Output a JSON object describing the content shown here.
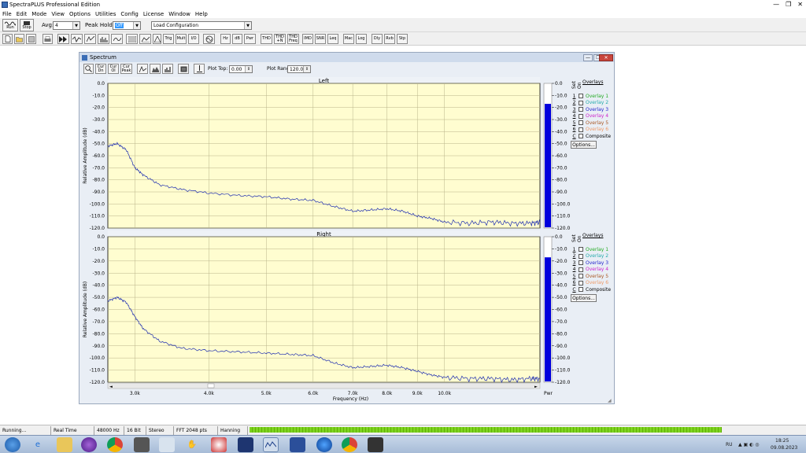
{
  "app": {
    "title": "SpectraPLUS Professional Edition"
  },
  "window_controls": {
    "minimize": "—",
    "restore": "❐",
    "close": "✕"
  },
  "menu": [
    "File",
    "Edit",
    "Mode",
    "View",
    "Options",
    "Utilities",
    "Config",
    "License",
    "Window",
    "Help"
  ],
  "toolbar": {
    "run_label": "Run",
    "stop_label": "Stop",
    "avg_label": "Avg:",
    "avg_value": "4",
    "peak_hold_label": "Peak Hold:",
    "peak_hold_value": "Off",
    "config_value": "Load Configuration",
    "text_buttons": [
      "Hz",
      "dB",
      "Pwr",
      "THD",
      "THD +N",
      "THD Freq",
      "IMD",
      "SNR",
      "Leq",
      "Mac",
      "Log",
      "Dly",
      "Rvb",
      "Stp"
    ],
    "icon_buttons": [
      "new-file-icon",
      "open-folder-icon",
      "save-icon",
      "print-icon",
      "play-icon",
      "record-icon",
      "waveform-icon",
      "spectrum-icon",
      "settings-icon",
      "calibration-icon",
      "trigger-icon"
    ],
    "trig_label": "Trig",
    "mult_label": "Mult",
    "io_label": "I/O"
  },
  "spectrum_window": {
    "title": "Spectrum",
    "small_buttons": [
      "Cur Dn",
      "Cur Ol",
      "Cur Peak"
    ],
    "plot_top_label": "Plot Top:",
    "plot_top_value": "0.00",
    "plot_range_label": "Plot Range:",
    "plot_range_value": "120.0"
  },
  "chart_data": [
    {
      "type": "line",
      "title": "Left",
      "ylabel": "Relative Amplitude (dB)",
      "xlabel": "",
      "x_scale": "log",
      "y_ticks": [
        "0.0",
        "-10.0",
        "-20.0",
        "-30.0",
        "-40.0",
        "-50.0",
        "-60.0",
        "-70.0",
        "-80.0",
        "-90.0",
        "-100.0",
        "-110.0",
        "-120.0"
      ],
      "ylim": [
        -120,
        0
      ],
      "xlim": [
        2700,
        14500
      ],
      "series": [
        {
          "x": [
            2700,
            2800,
            2900,
            3000,
            3100,
            3300,
            3600,
            4000,
            4500,
            5000,
            5500,
            6000,
            6500,
            7000,
            7500,
            8000,
            8500,
            9000,
            9500,
            10000,
            11000,
            12000,
            13000,
            14000,
            14500
          ],
          "values": [
            -52,
            -50,
            -55,
            -70,
            -76,
            -84,
            -88,
            -91,
            -93,
            -94,
            -96,
            -97,
            -102,
            -106,
            -105,
            -104,
            -106,
            -110,
            -112,
            -115,
            -116,
            -115,
            -116,
            -116,
            -115
          ]
        }
      ],
      "meter": {
        "value": -17,
        "ticks": [
          "0.0",
          "-10.0",
          "-20.0",
          "-30.0",
          "-40.0",
          "-50.0",
          "-60.0",
          "-70.0",
          "-80.0",
          "-90.0",
          "-100.0",
          "-110.0",
          "-120.0"
        ]
      }
    },
    {
      "type": "line",
      "title": "Right",
      "ylabel": "Relative Amplitude (dB)",
      "xlabel": "Frequency (Hz)",
      "x_scale": "log",
      "x_ticks": [
        "3.0k",
        "4.0k",
        "5.0k",
        "6.0k",
        "7.0k",
        "8.0k",
        "9.0k",
        "10.0k"
      ],
      "y_ticks": [
        "0.0",
        "-10.0",
        "-20.0",
        "-30.0",
        "-40.0",
        "-50.0",
        "-60.0",
        "-70.0",
        "-80.0",
        "-90.0",
        "-100.0",
        "-110.0",
        "-120.0"
      ],
      "ylim": [
        -120,
        0
      ],
      "xlim": [
        2700,
        14500
      ],
      "series": [
        {
          "x": [
            2700,
            2800,
            2900,
            3000,
            3100,
            3300,
            3600,
            4000,
            4500,
            5000,
            5500,
            6000,
            6500,
            7000,
            7500,
            8000,
            8500,
            9000,
            9500,
            10000,
            11000,
            12000,
            13000,
            14000,
            14500
          ],
          "values": [
            -53,
            -50,
            -54,
            -66,
            -76,
            -86,
            -92,
            -94,
            -95,
            -96,
            -97,
            -98,
            -104,
            -108,
            -107,
            -106,
            -108,
            -111,
            -114,
            -116,
            -117,
            -117,
            -118,
            -117,
            -117
          ]
        }
      ],
      "meter": {
        "value": -17,
        "ticks": [
          "0.0",
          "-10.0",
          "-20.0",
          "-30.0",
          "-40.0",
          "-50.0",
          "-60.0",
          "-70.0",
          "-80.0",
          "-90.0",
          "-100.0",
          "-110.0",
          "-120.0"
        ]
      },
      "meter_label": "Pwr"
    }
  ],
  "overlays": {
    "header": "Overlays",
    "col_set": "Set",
    "col_on": "On",
    "items": [
      {
        "num": "1",
        "label": "Overlay 1",
        "color": "#22aa22"
      },
      {
        "num": "2",
        "label": "Overlay 2",
        "color": "#22aaaa"
      },
      {
        "num": "3",
        "label": "Overlay 3",
        "color": "#2222cc"
      },
      {
        "num": "4",
        "label": "Overlay 4",
        "color": "#cc22cc"
      },
      {
        "num": "5",
        "label": "Overlay 5",
        "color": "#aa5522"
      },
      {
        "num": "6",
        "label": "Overlay 6",
        "color": "#ee9966"
      },
      {
        "num": "C",
        "label": "Composite",
        "color": "#000000"
      }
    ],
    "options_label": "Options..."
  },
  "status": {
    "state": "Running...",
    "mode": "Real Time",
    "rate": "48000 Hz",
    "bits": "16 Bit",
    "channels": "Stereo",
    "fft": "FFT 2048 pts",
    "window": "Hanning"
  },
  "taskbar": {
    "icons": [
      "start-orb-icon",
      "internet-explorer-icon",
      "file-explorer-icon",
      "media-player-icon",
      "chrome-icon",
      "network-icon",
      "document-icon",
      "hand-icon",
      "tool-icon",
      "app-icon",
      "spectraplus-icon",
      "settings-gear-icon",
      "globe-icon",
      "chrome-icon",
      "terminal-icon"
    ],
    "lang": "RU",
    "time": "18:25",
    "date": "09.08.2023"
  }
}
